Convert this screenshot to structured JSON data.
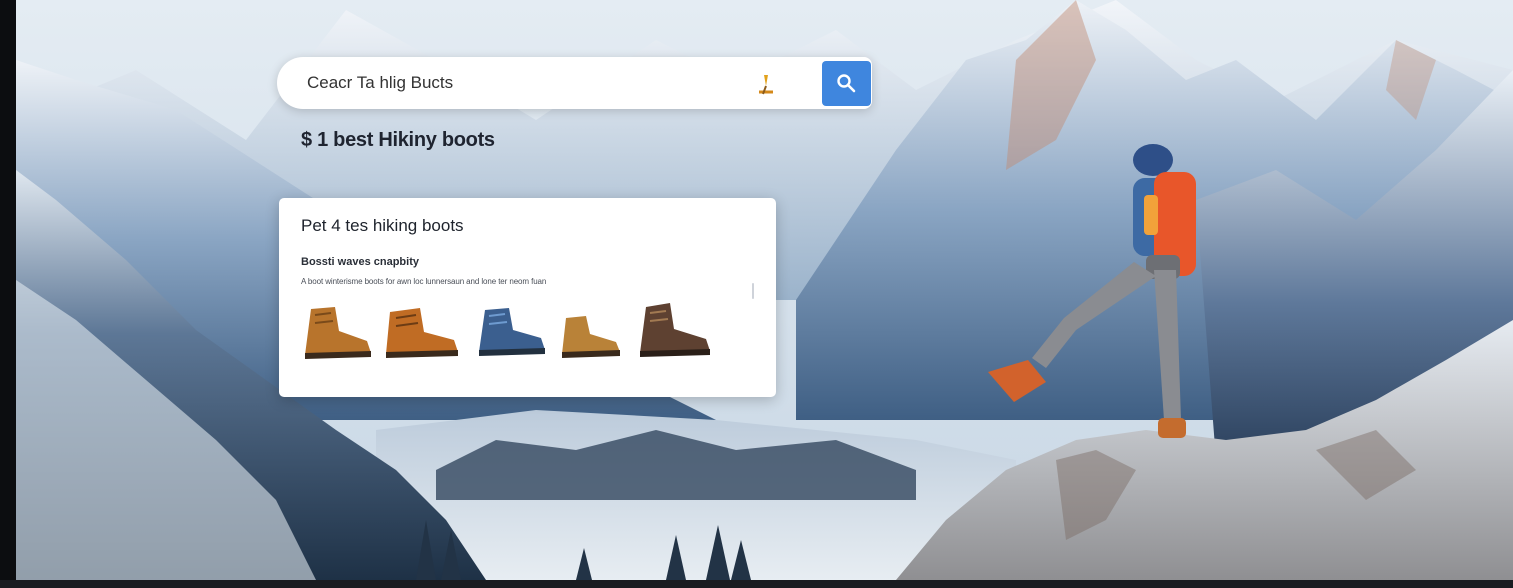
{
  "search": {
    "value": "Ceacr Ta hlig Bucts",
    "mic_icon": "microphone-icon",
    "button_icon": "search-icon"
  },
  "suggestion": "$ 1 best Hikiny boots",
  "result_card": {
    "title": "Pet 4 tes hiking boots",
    "subtitle": "Bossti waves cnapbity",
    "description": "A boot winterisme boots for awn loc lunnersaun and lone ter neom fuan",
    "products": [
      {
        "name": "tan-suede-hiking-boot",
        "color": "#b8742c"
      },
      {
        "name": "orange-leather-hiking-boot",
        "color": "#c06c24"
      },
      {
        "name": "blue-hiking-boot",
        "color": "#3b5f8f"
      },
      {
        "name": "camel-hiking-boot",
        "color": "#b98238"
      },
      {
        "name": "brown-leather-hiking-boot",
        "color": "#5e4131"
      }
    ]
  },
  "colors": {
    "search_button": "#3f86de",
    "hiker_backpack": "#e8562a",
    "sky": "#d6e3ee"
  }
}
